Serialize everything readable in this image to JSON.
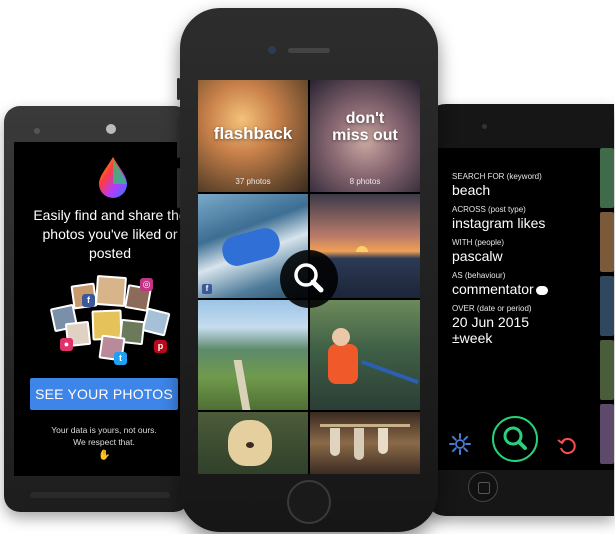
{
  "left_app": {
    "tagline": "Easily find and share the photos you've liked or posted",
    "cta_label": "SEE YOUR PHOTOS",
    "footnote_line1": "Your data is yours, not ours.",
    "footnote_line2": "We respect that.",
    "logo_icon": "rainbow-drop-icon"
  },
  "center_app": {
    "tiles": [
      {
        "title": "flashback",
        "count": "37 photos"
      },
      {
        "title": "don't miss out",
        "count": "8 photos"
      }
    ],
    "search_icon": "magnifier-icon"
  },
  "right_app": {
    "fields": [
      {
        "label": "SEARCH FOR (keyword)",
        "value": "beach"
      },
      {
        "label": "ACROSS (post type)",
        "value": "instagram likes"
      },
      {
        "label": "WITH (people)",
        "value": "pascalw"
      },
      {
        "label": "AS (behaviour)",
        "value": "commentator"
      },
      {
        "label": "OVER (date or period)",
        "value": "20 Jun 2015",
        "value2": "±week"
      }
    ],
    "accent_color": "#29d17a",
    "settings_icon": "gear-icon",
    "reset_icon": "undo-icon"
  }
}
